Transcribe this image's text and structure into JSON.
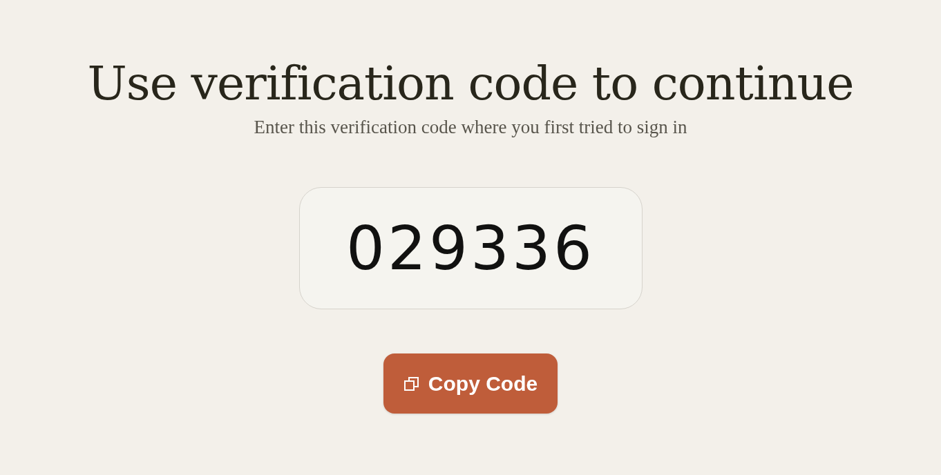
{
  "heading": "Use verification code to continue",
  "subheading": "Enter this verification code where you first tried to sign in",
  "code": "029336",
  "copy_button": {
    "label": "Copy Code"
  }
}
